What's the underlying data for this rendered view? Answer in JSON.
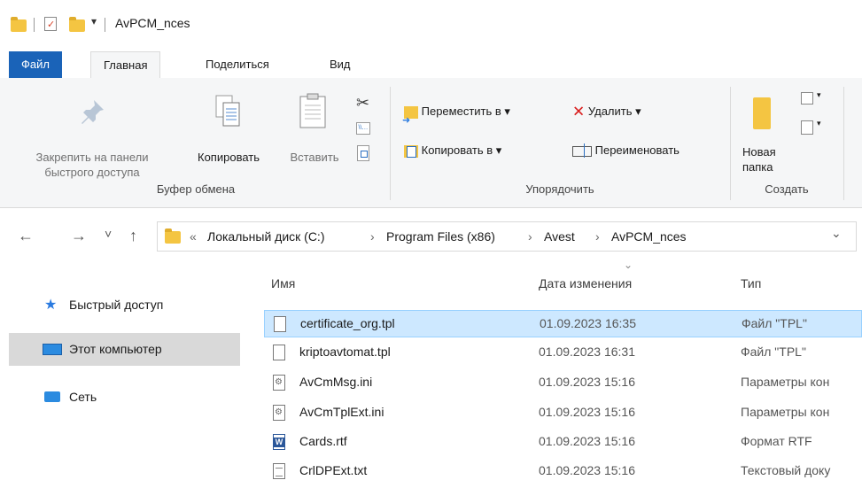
{
  "title_bar": {
    "title": "AvPCM_nces",
    "qat_arrow": "▾"
  },
  "tabs": [
    {
      "label": "Файл"
    },
    {
      "label": "Главная"
    },
    {
      "label": "Поделиться"
    },
    {
      "label": "Вид"
    }
  ],
  "ribbon": {
    "pin": {
      "line1": "Закрепить на панели",
      "line2": "быстрого доступа"
    },
    "copy": "Копировать",
    "paste": "Вставить",
    "group_clipboard": "Буфер обмена",
    "move_to": "Переместить в ▾",
    "copy_to": "Копировать в ▾",
    "delete": "Удалить ▾",
    "rename": "Переименовать",
    "group_organize": "Упорядочить",
    "new_folder": {
      "line1": "Новая",
      "line2": "папка"
    },
    "group_create": "Создать"
  },
  "nav": {
    "back": "←",
    "forward": "→",
    "recent": "˅",
    "up": "↑",
    "overflow": "«",
    "crumbs": [
      "Локальный диск (C:)",
      "Program Files (x86)",
      "Avest",
      "AvPCM_nces"
    ],
    "crumb_sep": "›",
    "dropdown": "⌄"
  },
  "sidebar": [
    {
      "label": "Быстрый доступ"
    },
    {
      "label": "Этот компьютер"
    },
    {
      "label": "Сеть"
    }
  ],
  "columns": {
    "name": "Имя",
    "date": "Дата изменения",
    "type": "Тип",
    "sort_indicator": "⌄"
  },
  "files": [
    {
      "name": "certificate_org.tpl",
      "date": "01.09.2023 16:35",
      "type": "Файл \"TPL\"",
      "icon": "file-icon"
    },
    {
      "name": "kriptoavtomat.tpl",
      "date": "01.09.2023 16:31",
      "type": "Файл \"TPL\"",
      "icon": "file-icon"
    },
    {
      "name": "AvCmMsg.ini",
      "date": "01.09.2023 15:16",
      "type": "Параметры кон",
      "icon": "settings-file-icon"
    },
    {
      "name": "AvCmTplExt.ini",
      "date": "01.09.2023 15:16",
      "type": "Параметры кон",
      "icon": "settings-file-icon"
    },
    {
      "name": "Cards.rtf",
      "date": "01.09.2023 15:16",
      "type": "Формат RTF",
      "icon": "word-document-icon"
    },
    {
      "name": "CrlDPExt.txt",
      "date": "01.09.2023 15:16",
      "type": "Текстовый доку",
      "icon": "text-file-icon"
    }
  ],
  "colors": {
    "accent": "#1a63b8",
    "selection": "#cde8ff",
    "folder": "#f4c542"
  }
}
